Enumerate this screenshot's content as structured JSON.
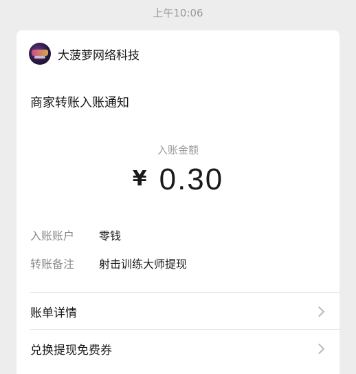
{
  "status_time": "上午10:06",
  "merchant": {
    "name": "大菠萝网络科技"
  },
  "notice_title": "商家转账入账通知",
  "amount": {
    "label": "入账金额",
    "currency": "¥",
    "value": "0.30"
  },
  "details": [
    {
      "key": "入账账户",
      "value": "零钱"
    },
    {
      "key": "转账备注",
      "value": "射击训练大师提现"
    }
  ],
  "links": [
    {
      "label": "账单详情"
    },
    {
      "label": "兑换提现免费券"
    }
  ],
  "icons": {
    "merchant_avatar": "game-logo-avatar",
    "chevron": "chevron-right-icon"
  }
}
